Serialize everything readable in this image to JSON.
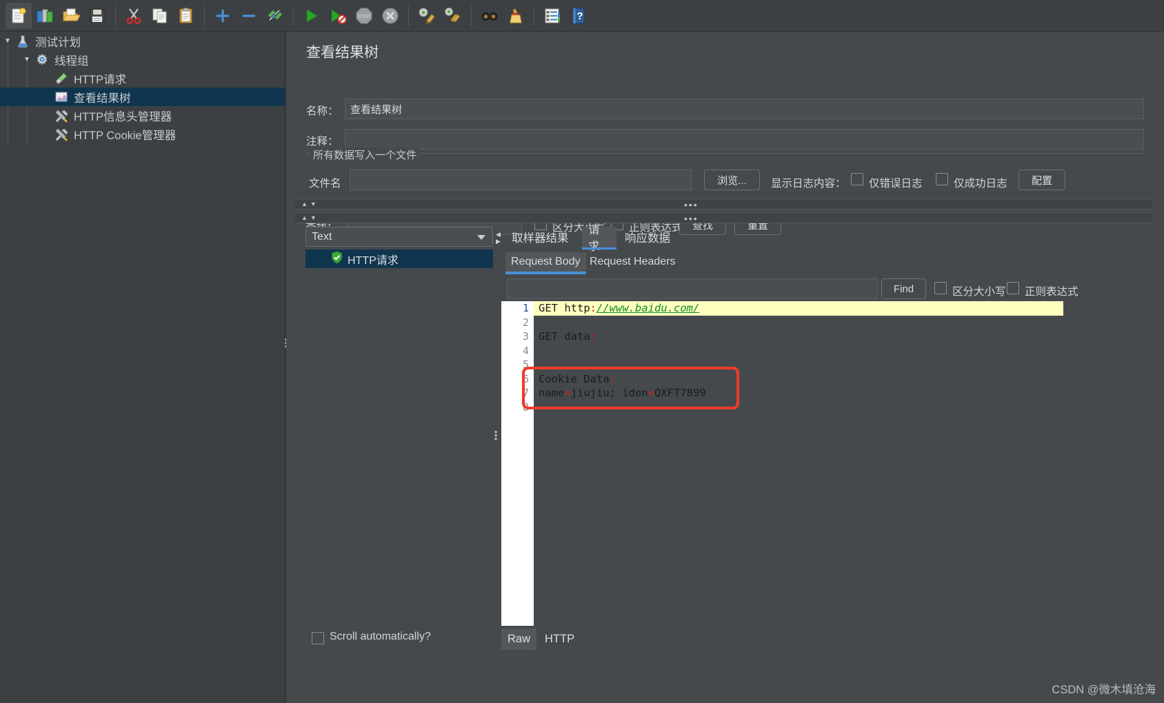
{
  "toolbar": {
    "buttons": [
      {
        "name": "new-icon",
        "glyph": "🗒",
        "title": "新建"
      },
      {
        "name": "templates-icon",
        "glyph": "📚",
        "title": "模板"
      },
      {
        "name": "open-icon",
        "glyph": "📂",
        "title": "打开"
      },
      {
        "name": "save-icon",
        "glyph": "💾",
        "title": "保存"
      },
      {
        "name": "cut-icon",
        "glyph": "✂",
        "title": "剪切"
      },
      {
        "name": "copy-icon",
        "glyph": "🗐",
        "title": "复制"
      },
      {
        "name": "paste-icon",
        "glyph": "📋",
        "title": "粘贴"
      },
      {
        "name": "expand-all-icon",
        "glyph": "＋",
        "title": "展开全部"
      },
      {
        "name": "collapse-all-icon",
        "glyph": "−",
        "title": "折叠全部"
      },
      {
        "name": "toggle-icon",
        "glyph": "✎",
        "title": "启用/禁用"
      },
      {
        "name": "start-icon",
        "glyph": "▶",
        "title": "启动"
      },
      {
        "name": "start-no-pauses-icon",
        "glyph": "▶",
        "title": "无间隔启动"
      },
      {
        "name": "stop-icon",
        "glyph": "STOP",
        "title": "停止"
      },
      {
        "name": "shutdown-icon",
        "glyph": "✖",
        "title": "关闭"
      },
      {
        "name": "clear-icon",
        "glyph": "🧹",
        "title": "清除"
      },
      {
        "name": "clear-all-icon",
        "glyph": "🧹",
        "title": "清除全部"
      },
      {
        "name": "search-icon",
        "glyph": "🔍",
        "title": "搜索"
      },
      {
        "name": "reset-search-icon",
        "glyph": "🧹",
        "title": "重置搜索"
      },
      {
        "name": "function-helper-icon",
        "glyph": "▤",
        "title": "函数助手对话框"
      },
      {
        "name": "help-icon",
        "glyph": "?",
        "title": "帮助"
      }
    ]
  },
  "sidebar": {
    "items": [
      {
        "label": "测试计划",
        "icon": "test-plan-icon",
        "depth": 0,
        "twisty": "▼",
        "selected": false
      },
      {
        "label": "线程组",
        "icon": "thread-group-icon",
        "depth": 1,
        "twisty": "▼",
        "selected": false
      },
      {
        "label": "HTTP请求",
        "icon": "http-request-icon",
        "depth": 2,
        "twisty": "",
        "selected": false
      },
      {
        "label": "查看结果树",
        "icon": "view-results-tree-icon",
        "depth": 2,
        "twisty": "",
        "selected": true
      },
      {
        "label": "HTTP信息头管理器",
        "icon": "header-manager-icon",
        "depth": 2,
        "twisty": "",
        "selected": false
      },
      {
        "label": "HTTP Cookie管理器",
        "icon": "cookie-manager-icon",
        "depth": 2,
        "twisty": "",
        "selected": false
      }
    ]
  },
  "panel": {
    "title": "查看结果树",
    "name_label": "名称：",
    "name_value": "查看结果树",
    "comment_label": "注释：",
    "comment_value": "",
    "file_group_title": "所有数据写入一个文件",
    "filename_label": "文件名",
    "filename_value": "",
    "browse_button": "浏览...",
    "log_display_label": "显示日志内容：",
    "errors_only_label": "仅错误日志",
    "successes_only_label": "仅成功日志",
    "configure_button": "配置"
  },
  "search": {
    "label": "查找：",
    "value": "",
    "case_sensitive_label": "区分大小写",
    "regex_label": "正则表达式",
    "find_button": "查找",
    "reset_button": "重置"
  },
  "results": {
    "render_type": "Text",
    "tree_items": [
      {
        "label": "HTTP请求",
        "status": "success",
        "selected": true
      }
    ],
    "scroll_auto_label": "Scroll automatically?"
  },
  "tabs": {
    "main": [
      {
        "label": "取样器结果",
        "active": false
      },
      {
        "label": "请求",
        "active": true
      },
      {
        "label": "响应数据",
        "active": false
      }
    ],
    "sub": [
      {
        "label": "Request Body",
        "active": true
      },
      {
        "label": "Request Headers",
        "active": false
      }
    ]
  },
  "find_bar": {
    "value": "",
    "find_button": "Find",
    "case_sensitive_label": "区分大小写",
    "regex_label": "正则表达式"
  },
  "code": {
    "lines": [
      {
        "num": "1",
        "highlight": true,
        "segments": [
          {
            "t": "GET http",
            "c": "plain"
          },
          {
            "t": ":",
            "c": "punct"
          },
          {
            "t": "//",
            "c": "url"
          },
          {
            "t": "www.baidu.com/",
            "c": "url"
          }
        ]
      },
      {
        "num": "2",
        "highlight": false,
        "segments": []
      },
      {
        "num": "3",
        "highlight": false,
        "segments": [
          {
            "t": "GET data",
            "c": "plain"
          },
          {
            "t": ":",
            "c": "punct"
          }
        ]
      },
      {
        "num": "4",
        "highlight": false,
        "segments": []
      },
      {
        "num": "5",
        "highlight": false,
        "segments": []
      },
      {
        "num": "6",
        "highlight": false,
        "segments": [
          {
            "t": "Cookie Data",
            "c": "plain"
          },
          {
            "t": ":",
            "c": "punct"
          }
        ]
      },
      {
        "num": "7",
        "highlight": false,
        "segments": [
          {
            "t": "name",
            "c": "plain"
          },
          {
            "t": "=",
            "c": "punct"
          },
          {
            "t": "jiujiu; iden",
            "c": "plain"
          },
          {
            "t": "=",
            "c": "punct"
          },
          {
            "t": "QXFT7899",
            "c": "plain"
          }
        ]
      },
      {
        "num": "8",
        "highlight": false,
        "segments": []
      }
    ]
  },
  "raw_bar": {
    "tabs": [
      {
        "label": "Raw",
        "active": true
      },
      {
        "label": "HTTP",
        "active": false
      }
    ]
  },
  "watermark": "CSDN @微木填沧海",
  "colors": {
    "accent": "#4a90d9",
    "selection": "#10364f",
    "annotation": "#ed3b27",
    "highlight": "#ffffbe",
    "window_bg": "#3c4043",
    "panel_bg": "#45494c"
  }
}
